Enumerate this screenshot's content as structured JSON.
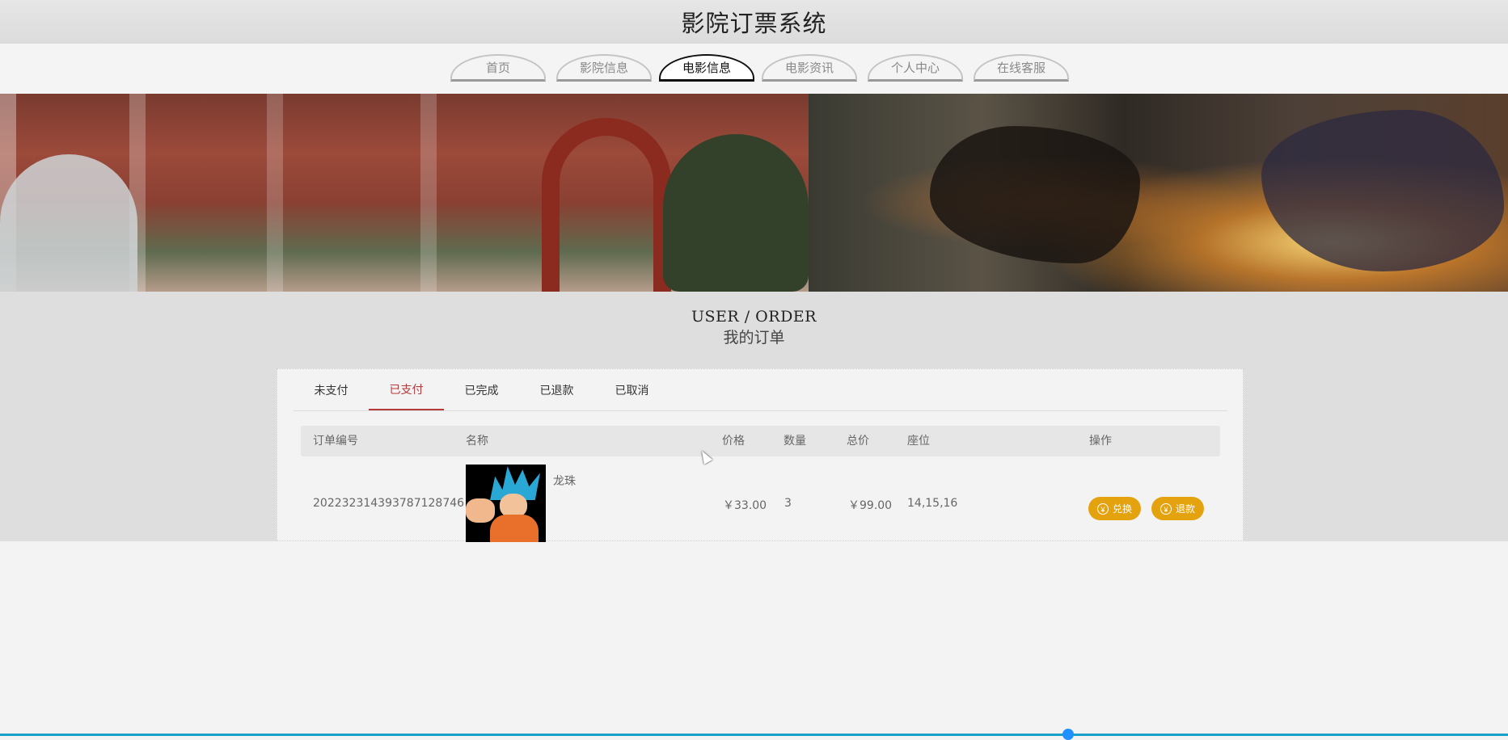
{
  "header": {
    "title": "影院订票系统"
  },
  "nav": {
    "items": [
      {
        "label": "首页"
      },
      {
        "label": "影院信息"
      },
      {
        "label": "电影信息"
      },
      {
        "label": "电影资讯"
      },
      {
        "label": "个人中心"
      },
      {
        "label": "在线客服"
      }
    ],
    "active_index": 2
  },
  "section": {
    "title_en": "USER / ORDER",
    "title_cn": "我的订单"
  },
  "orders": {
    "tabs": [
      {
        "label": "未支付"
      },
      {
        "label": "已支付"
      },
      {
        "label": "已完成"
      },
      {
        "label": "已退款"
      },
      {
        "label": "已取消"
      }
    ],
    "active_tab_index": 1,
    "columns": [
      "订单编号",
      "名称",
      "价格",
      "数量",
      "总价",
      "座位",
      "操作"
    ],
    "rows": [
      {
        "order_no": "20223231439378712874 6",
        "name": "龙珠",
        "price": "￥33.00",
        "quantity": "3",
        "total": "￥99.00",
        "seats": "14,15,16",
        "actions": [
          {
            "label": "兑换",
            "icon": "yen-icon"
          },
          {
            "label": "退款",
            "icon": "yen-icon"
          }
        ]
      }
    ]
  },
  "colors": {
    "accent_red": "#b53a3a",
    "button_yellow": "#e5a20f"
  }
}
